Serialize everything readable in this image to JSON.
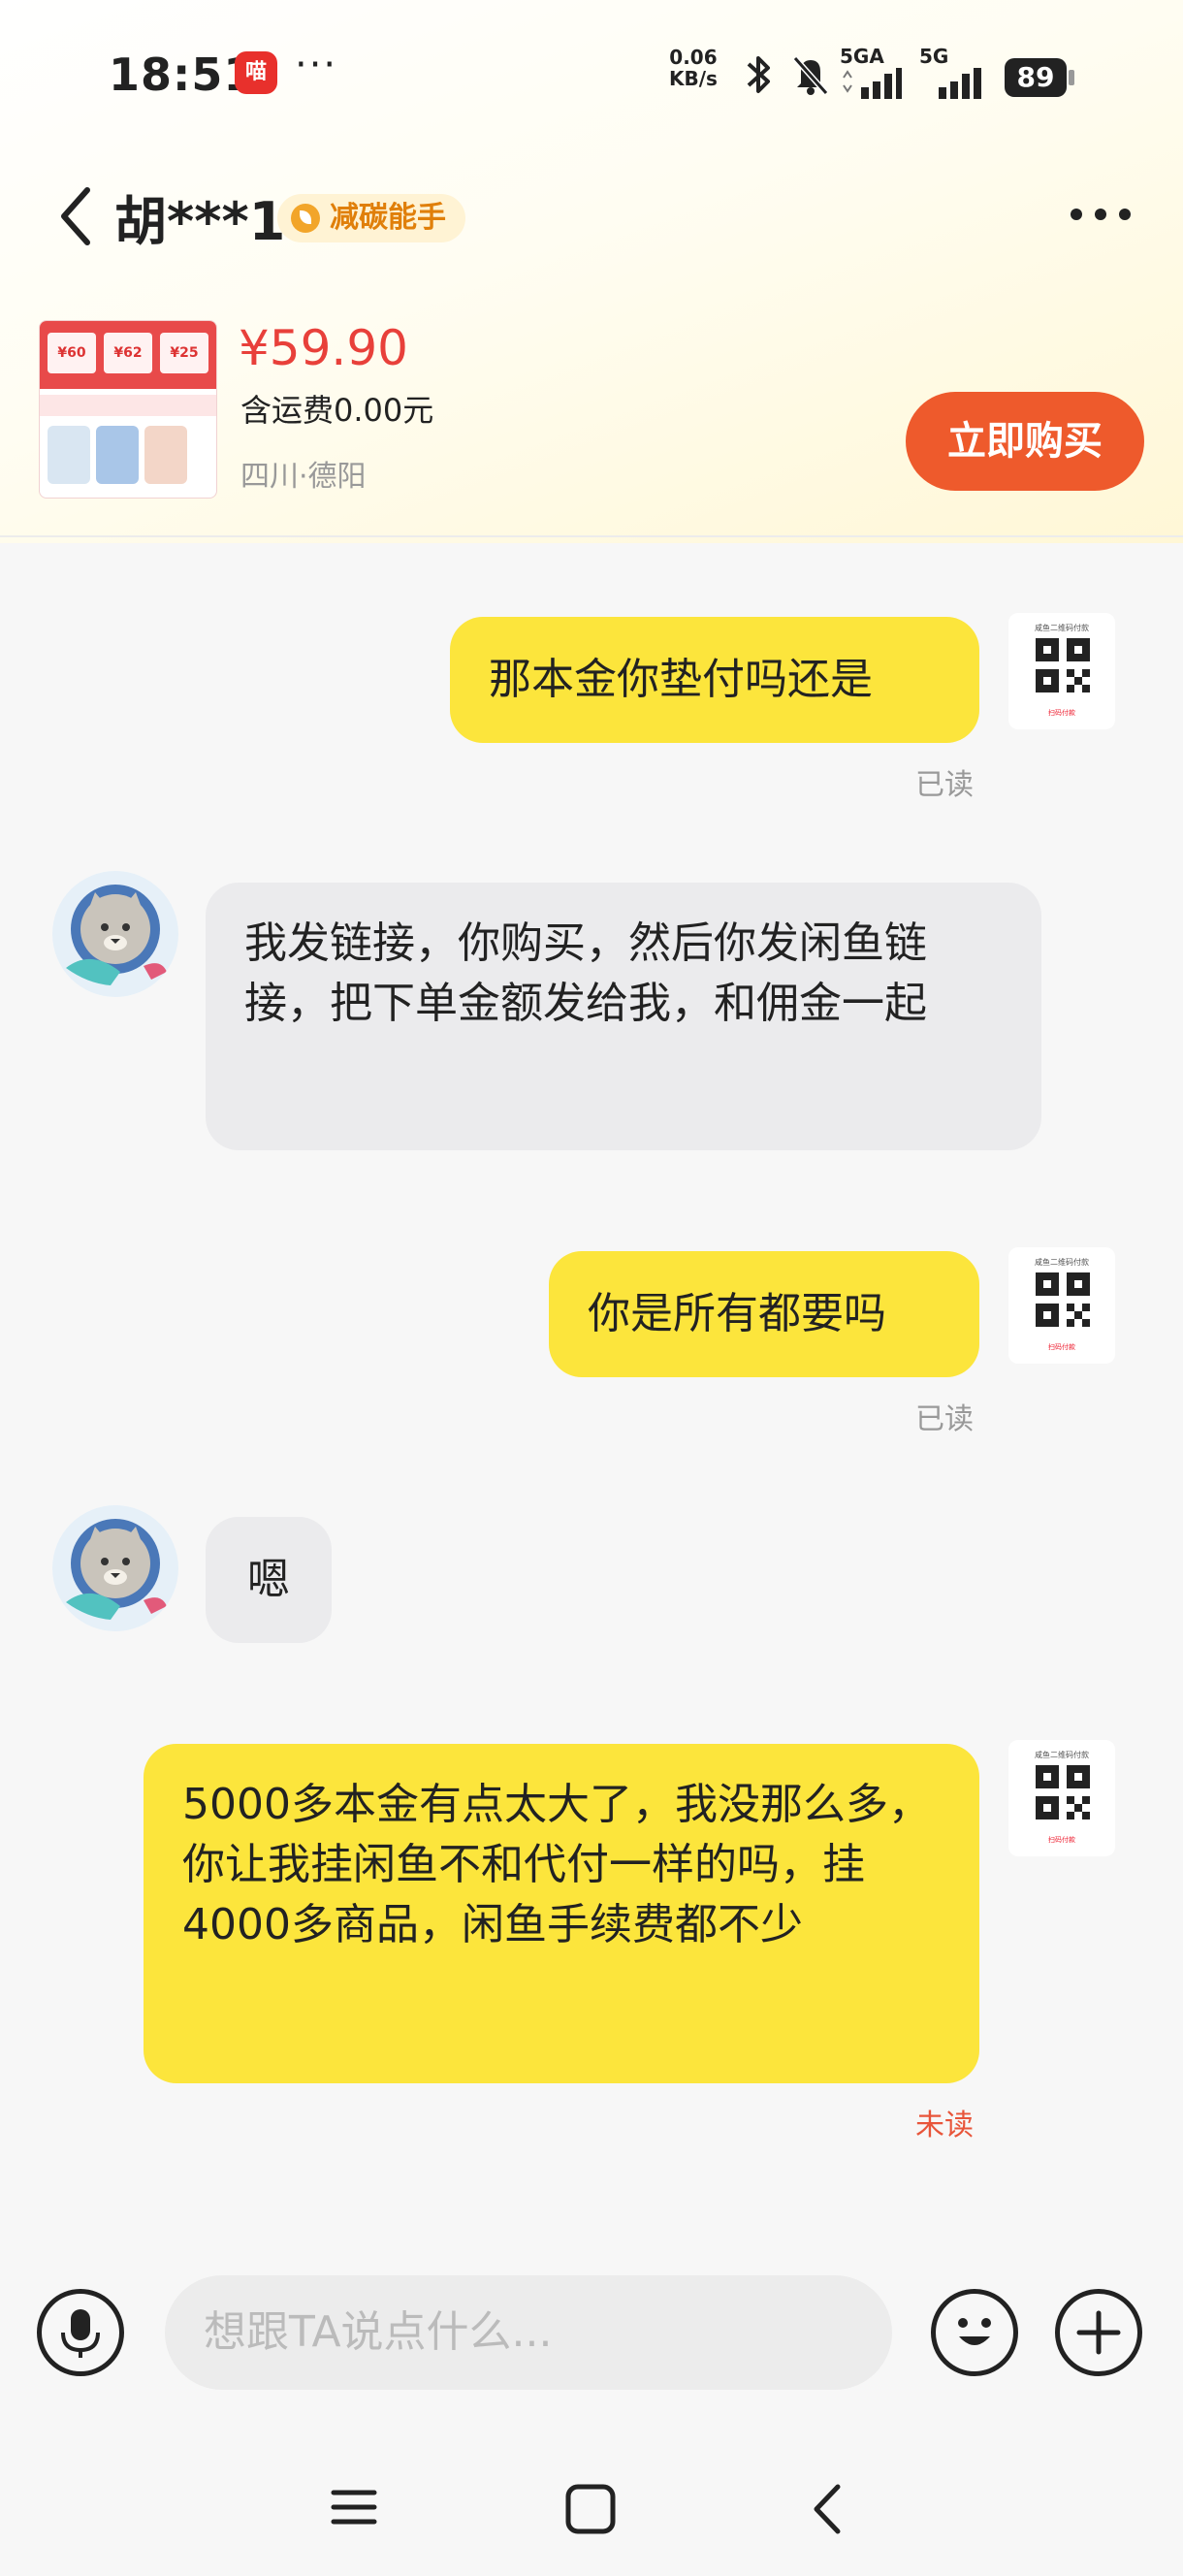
{
  "status_bar": {
    "time": "18:51",
    "more": "···",
    "net_speed_value": "0.06",
    "net_speed_unit": "KB/s",
    "sim1_label": "5GA",
    "sim2_label": "5G",
    "battery": "89"
  },
  "header": {
    "title": "胡***1",
    "badge": "减碳能手"
  },
  "product": {
    "price": "¥59.90",
    "shipping": "含运费0.00元",
    "location": "四川·德阳",
    "buy_label": "立即购买"
  },
  "messages": [
    {
      "side": "out",
      "text": "那本金你垫付吗还是",
      "status": "已读"
    },
    {
      "side": "in",
      "text": "我发链接，你购买，然后你发闲鱼链接，把下单金额发给我，和佣金一起"
    },
    {
      "side": "out",
      "text": "你是所有都要吗",
      "status": "已读"
    },
    {
      "side": "in",
      "text": "嗯"
    },
    {
      "side": "out",
      "text": "5000多本金有点太大了，我没那么多，你让我挂闲鱼不和代付一样的吗，挂4000多商品，闲鱼手续费都不少",
      "status": "未读"
    }
  ],
  "input": {
    "placeholder": "想跟TA说点什么..."
  },
  "colors": {
    "outgoing_bubble": "#fce53c",
    "incoming_bubble": "#ebebed",
    "buy_button": "#ee5a2c",
    "price": "#e8403a",
    "unread": "#e8553a"
  },
  "icons": [
    "back-icon",
    "more-icon",
    "voice-icon",
    "emoji-icon",
    "add-icon",
    "menu-nav-icon",
    "home-nav-icon",
    "back-nav-icon"
  ]
}
